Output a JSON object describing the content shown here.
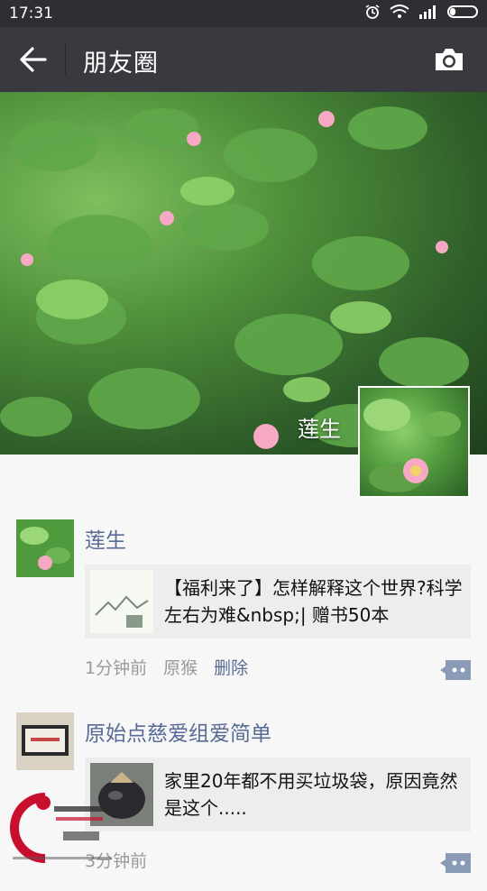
{
  "status_bar": {
    "time": "17:31"
  },
  "app_bar": {
    "title": "朋友圈"
  },
  "cover": {
    "user_name": "莲生"
  },
  "feed": [
    {
      "author": "莲生",
      "share_text": "【福利来了】怎样解释这个世界?科学左右为难&nbsp;| 赠书50本",
      "time": "1分钟前",
      "source": "原猴",
      "delete_label": "删除"
    },
    {
      "author": "原始点慈爱组爱简单",
      "share_text": "家里20年都不用买垃圾袋，原因竟然是这个.....",
      "time": "3分钟前"
    }
  ],
  "colors": {
    "status_bar_bg": "#2e2e33",
    "app_bar_bg": "#393a3f",
    "link_blue": "#576b95",
    "share_card_bg": "#ededed",
    "meta_gray": "#9a9a9a",
    "watermark_red": "#c8102e"
  },
  "icons": {
    "back": "arrow-left-icon",
    "camera": "camera-icon",
    "comment": "comment-dots-icon",
    "battery": "battery-icon",
    "wifi": "wifi-icon",
    "signal": "signal-icon",
    "alarm": "alarm-icon"
  }
}
